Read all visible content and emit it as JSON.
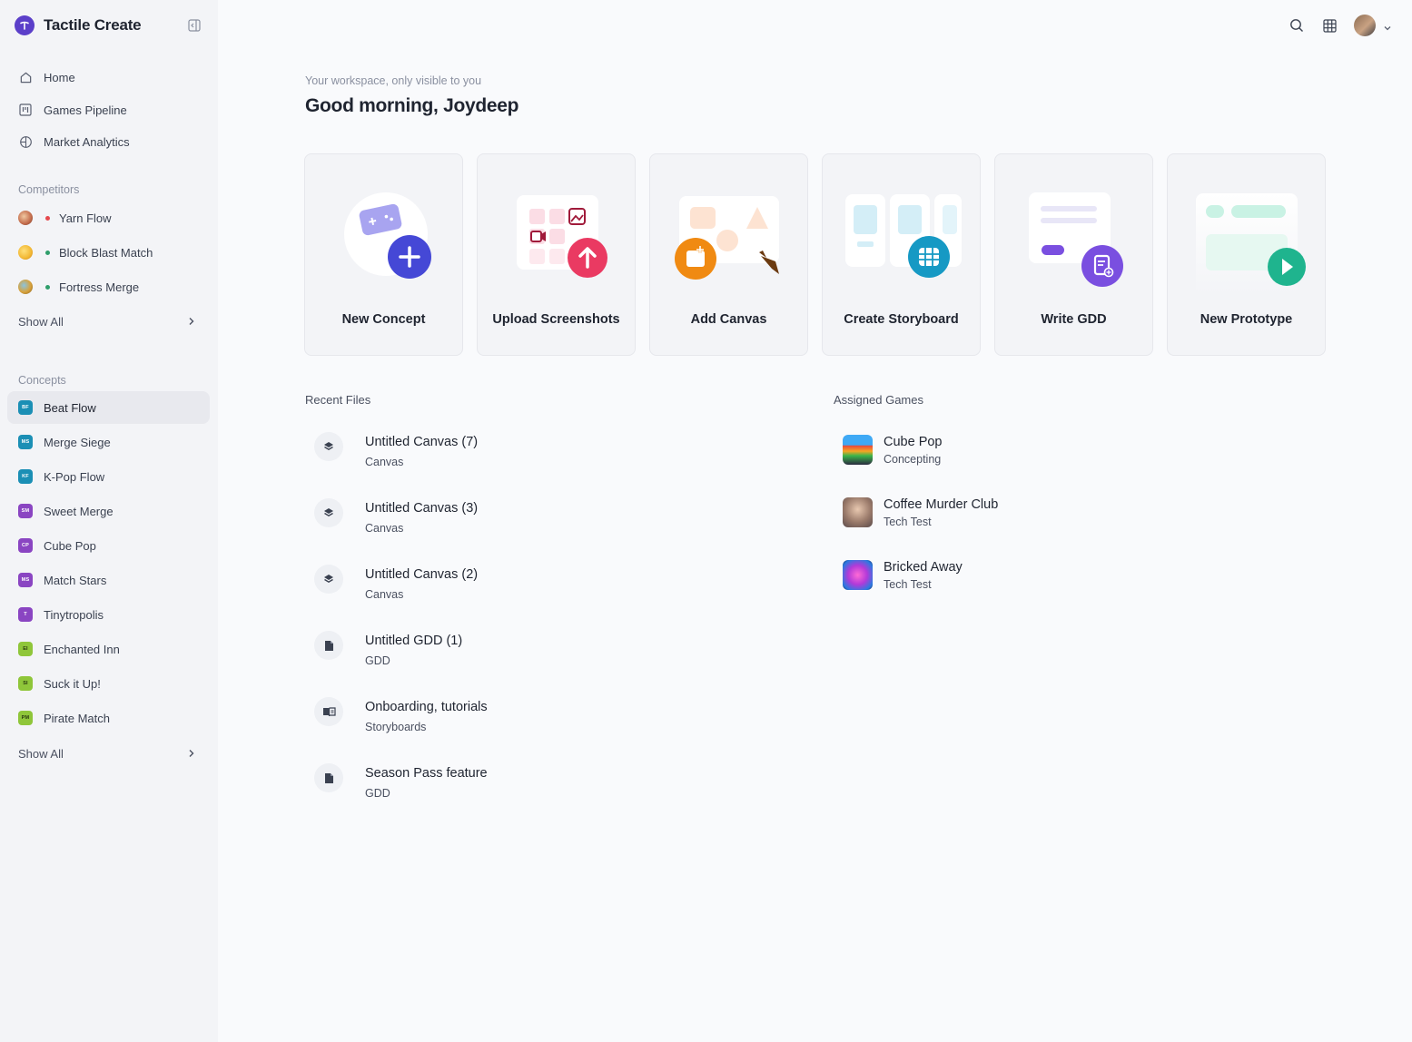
{
  "app": {
    "name": "Tactile Create"
  },
  "nav": [
    {
      "label": "Home",
      "icon": "home-icon"
    },
    {
      "label": "Games Pipeline",
      "icon": "kanban-icon"
    },
    {
      "label": "Market Analytics",
      "icon": "globe-icon"
    }
  ],
  "competitors": {
    "heading": "Competitors",
    "items": [
      {
        "label": "Yarn Flow",
        "status_color": "#e5484d",
        "avatar_color": "#c26a4a"
      },
      {
        "label": "Block Blast Match",
        "status_color": "#2f9e6b",
        "avatar_color": "#f2b733"
      },
      {
        "label": "Fortress Merge",
        "status_color": "#2f9e6b",
        "avatar_color": "#d9a23a"
      }
    ],
    "show_all": "Show All"
  },
  "concepts": {
    "heading": "Concepts",
    "items": [
      {
        "label": "Beat Flow",
        "abbr": "BF",
        "color": "#1b8fb5",
        "active": true
      },
      {
        "label": "Merge Siege",
        "abbr": "MS",
        "color": "#1b8fb5"
      },
      {
        "label": "K-Pop Flow",
        "abbr": "KF",
        "color": "#1b8fb5"
      },
      {
        "label": "Sweet Merge",
        "abbr": "SM",
        "color": "#8a45c2"
      },
      {
        "label": "Cube Pop",
        "abbr": "CP",
        "color": "#8a45c2"
      },
      {
        "label": "Match Stars",
        "abbr": "MS",
        "color": "#8a45c2"
      },
      {
        "label": "Tinytropolis",
        "abbr": "T",
        "color": "#8a45c2"
      },
      {
        "label": "Enchanted Inn",
        "abbr": "EI",
        "color": "#8fc63a"
      },
      {
        "label": "Suck it Up!",
        "abbr": "SI",
        "color": "#8fc63a"
      },
      {
        "label": "Pirate Match",
        "abbr": "PM",
        "color": "#8fc63a"
      }
    ],
    "show_all": "Show All"
  },
  "header": {
    "subtitle": "Your workspace, only visible to you",
    "greeting": "Good morning, Joydeep"
  },
  "actions": [
    {
      "label": "New Concept",
      "icon": "plus-icon",
      "color": "#4548d6"
    },
    {
      "label": "Upload Screenshots",
      "icon": "upload-arrow-icon",
      "color": "#ea3a62"
    },
    {
      "label": "Add Canvas",
      "icon": "image-add-icon",
      "color": "#f08a12"
    },
    {
      "label": "Create Storyboard",
      "icon": "grid-icon",
      "color": "#1699c4"
    },
    {
      "label": "Write GDD",
      "icon": "document-edit-icon",
      "color": "#7a4fe0"
    },
    {
      "label": "New Prototype",
      "icon": "play-icon",
      "color": "#1fb48e"
    }
  ],
  "recent_files": {
    "heading": "Recent Files",
    "items": [
      {
        "name": "Untitled Canvas (7)",
        "type": "Canvas",
        "icon": "layers-icon"
      },
      {
        "name": "Untitled Canvas (3)",
        "type": "Canvas",
        "icon": "layers-icon"
      },
      {
        "name": "Untitled Canvas (2)",
        "type": "Canvas",
        "icon": "layers-icon"
      },
      {
        "name": "Untitled GDD (1)",
        "type": "GDD",
        "icon": "document-icon"
      },
      {
        "name": "Onboarding, tutorials",
        "type": "Storyboards",
        "icon": "book-icon"
      },
      {
        "name": "Season Pass feature",
        "type": "GDD",
        "icon": "document-icon"
      }
    ]
  },
  "assigned_games": {
    "heading": "Assigned Games",
    "items": [
      {
        "name": "Cube Pop",
        "status": "Concepting"
      },
      {
        "name": "Coffee Murder Club",
        "status": "Tech Test"
      },
      {
        "name": "Bricked Away",
        "status": "Tech Test"
      }
    ]
  }
}
